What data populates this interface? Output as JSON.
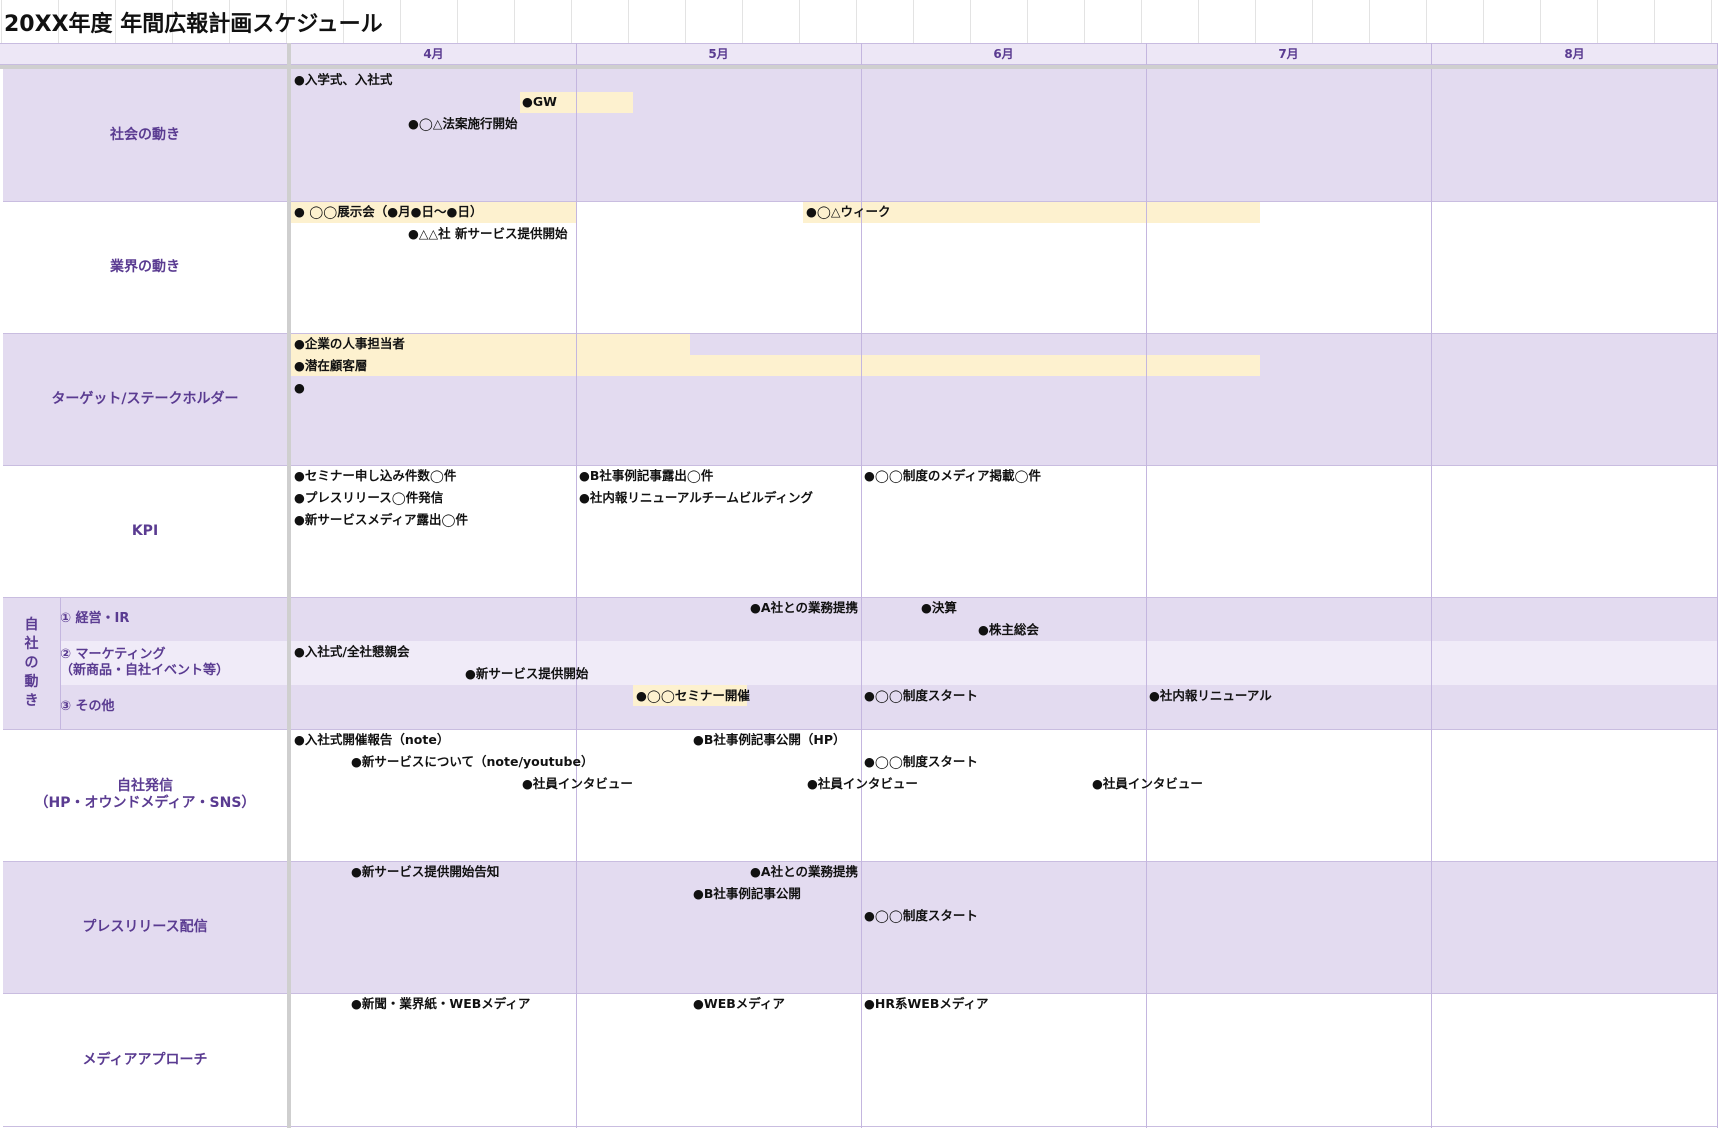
{
  "title": "20XX年度 年間広報計画スケジュール",
  "months": [
    "4月",
    "5月",
    "6月",
    "7月",
    "8月"
  ],
  "colors": {
    "category_text": "#5a3b91",
    "row_purple": "#e3dbf0",
    "row_light": "#f0ebf8",
    "highlight": "#fdf1cf",
    "grid_line": "#c4b6df"
  },
  "rows": {
    "society": {
      "label": "社会の動き",
      "events": [
        "●入学式、入社式",
        "●GW",
        "●◯△法案施行開始"
      ]
    },
    "industry": {
      "label": "業界の動き",
      "events": [
        "● ◯◯展示会（●月●日〜●日）",
        "●△△社 新サービス提供開始",
        "●◯△ウィーク"
      ]
    },
    "target": {
      "label": "ターゲット/ステークホルダー",
      "events": [
        "●企業の人事担当者",
        "●潜在顧客層",
        "●"
      ]
    },
    "kpi": {
      "label": "KPI",
      "events": [
        "●セミナー申し込み件数◯件",
        "●プレスリリース◯件発信",
        "●新サービスメディア露出◯件",
        "●B社事例記事露出◯件",
        "●社内報リニューアルチームビルディング",
        "●◯◯制度のメディア掲載◯件"
      ]
    },
    "own": {
      "label": "自社の動き",
      "sub1": {
        "label": "① 経営・IR",
        "events": [
          "●A社との業務提携",
          "●決算",
          "●株主総会"
        ]
      },
      "sub2": {
        "label": "② マーケティング\n（新商品・自社イベント等）",
        "events": [
          "●入社式/全社懇親会",
          "●新サービス提供開始"
        ]
      },
      "sub3": {
        "label": "③ その他",
        "events": [
          "●◯◯セミナー開催",
          "●◯◯制度スタート",
          "●社内報リニューアル"
        ]
      }
    },
    "owned_media": {
      "label": "自社発信\n（HP・オウンドメディア・SNS）",
      "events": [
        "●入社式開催報告（note）",
        "●新サービスについて（note/youtube）",
        "●社員インタビュー",
        "●B社事例記事公開（HP）",
        "●◯◯制度スタート",
        "●社員インタビュー",
        "●社員インタビュー"
      ]
    },
    "press": {
      "label": "プレスリリース配信",
      "events": [
        "●新サービス提供開始告知",
        "●A社との業務提携",
        "●B社事例記事公開",
        "●◯◯制度スタート"
      ]
    },
    "media": {
      "label": "メディアアプローチ",
      "events": [
        "●新聞・業界紙・WEBメディア",
        "●WEBメディア",
        "●HR系WEBメディア"
      ]
    }
  }
}
